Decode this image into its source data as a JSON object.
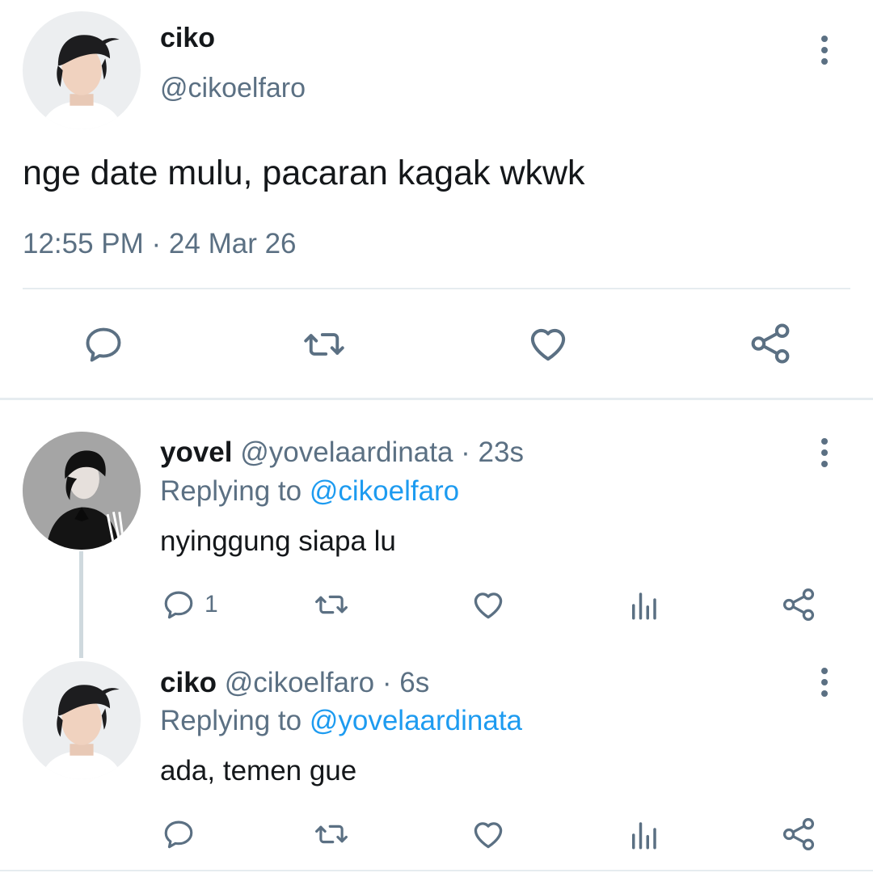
{
  "main_tweet": {
    "display_name": "ciko",
    "handle": "@cikoelfaro",
    "text": "nge date mulu, pacaran kagak wkwk",
    "timestamp": "12:55 PM · 24 Mar 26",
    "actions": [
      "reply-icon",
      "retweet-icon",
      "like-icon",
      "share-icon"
    ]
  },
  "replies": [
    {
      "display_name": "yovel",
      "handle": "@yovelaardinata",
      "time": "· 23s",
      "replying_label": "Replying to ",
      "replying_to": "@cikoelfaro",
      "text": "nyinggung siapa lu",
      "reply_count": "1",
      "actions": [
        "reply-icon",
        "retweet-icon",
        "like-icon",
        "analytics-icon",
        "share-icon"
      ]
    },
    {
      "display_name": "ciko",
      "handle": "@cikoelfaro",
      "time": "· 6s",
      "replying_label": "Replying to ",
      "replying_to": "@yovelaardinata",
      "text": "ada, temen gue",
      "reply_count": "",
      "actions": [
        "reply-icon",
        "retweet-icon",
        "like-icon",
        "analytics-icon",
        "share-icon"
      ]
    }
  ],
  "colors": {
    "text": "#14171a",
    "muted": "#5b7083",
    "link": "#1d9bf0",
    "divider": "#e6ecf0"
  }
}
